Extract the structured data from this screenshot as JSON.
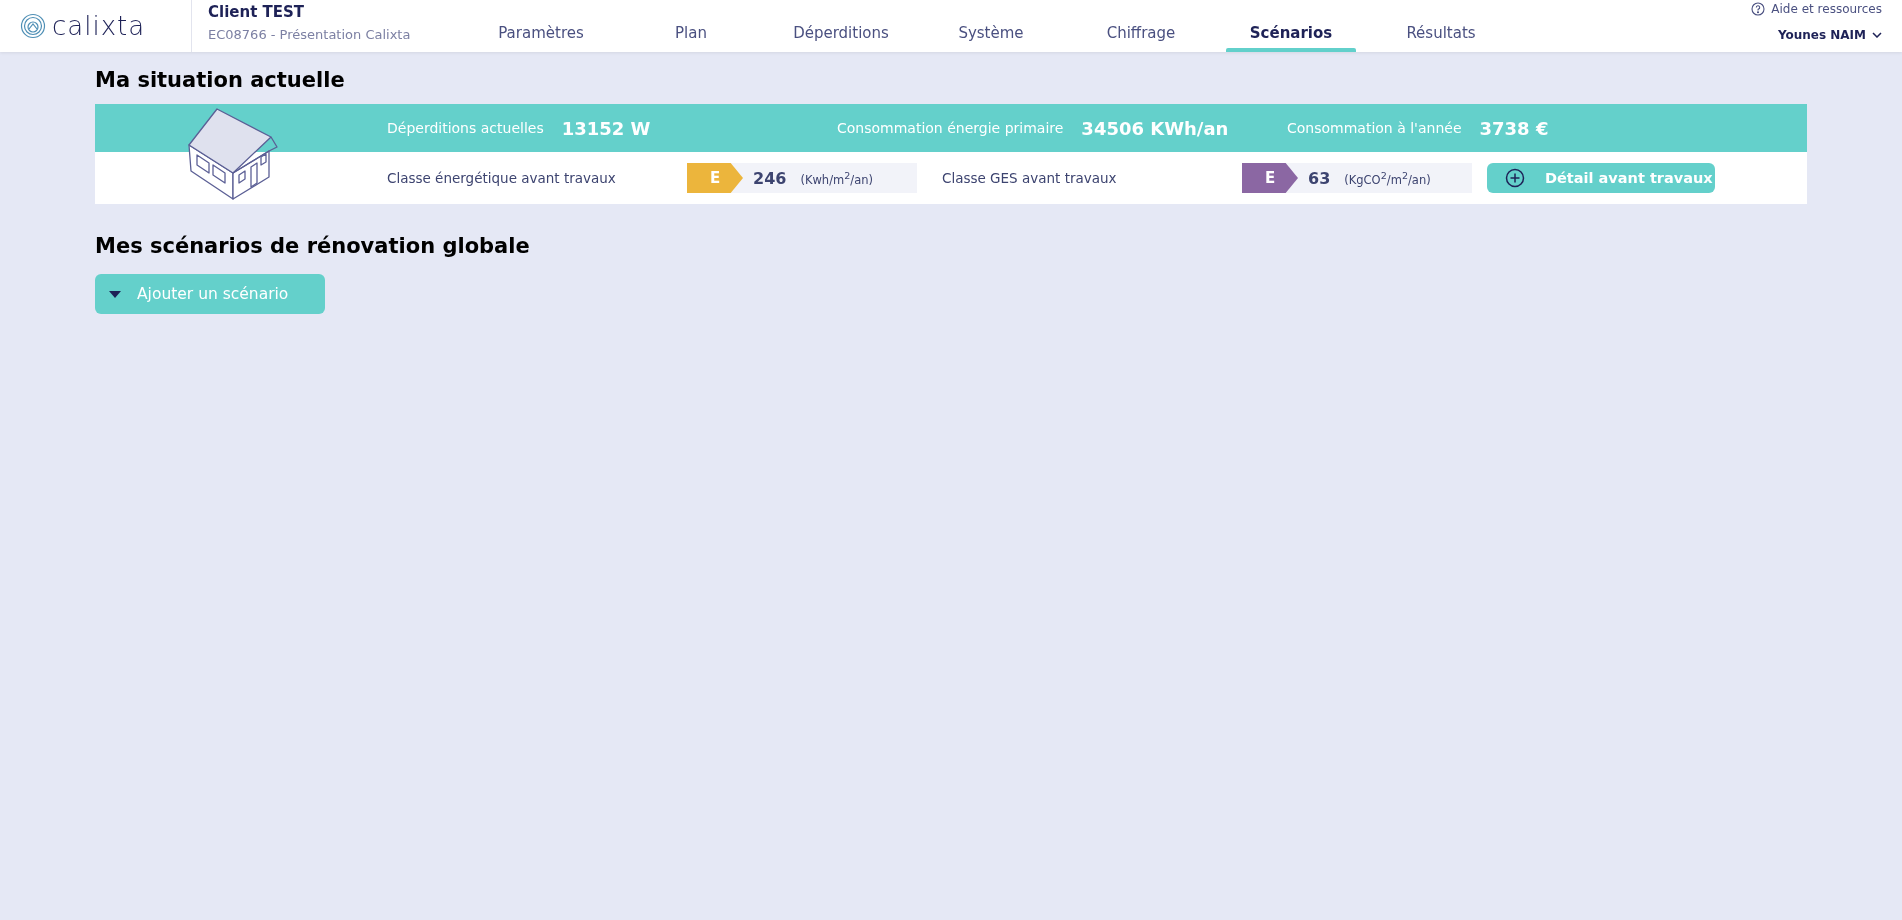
{
  "header": {
    "logo": "calixta",
    "client": "Client TEST",
    "project": "EC08766 - Présentation Calixta",
    "help": "Aide et ressources",
    "user": "Younes NAIM"
  },
  "tabs": [
    {
      "label": "Paramètres",
      "selected": false
    },
    {
      "label": "Plan",
      "selected": false
    },
    {
      "label": "Déperditions",
      "selected": false
    },
    {
      "label": "Système",
      "selected": false
    },
    {
      "label": "Chiffrage",
      "selected": false
    },
    {
      "label": "Scénarios",
      "selected": true
    },
    {
      "label": "Résultats",
      "selected": false
    }
  ],
  "situation": {
    "title": "Ma situation actuelle",
    "stats": [
      {
        "label": "Déperditions actuelles",
        "value": "13152 W"
      },
      {
        "label": "Consommation énergie primaire",
        "value": "34506 KWh/an"
      },
      {
        "label": "Consommation à l'année",
        "value": "3738 €"
      }
    ],
    "classes": [
      {
        "label": "Classe énergétique avant travaux",
        "grade": "E",
        "color": "#ecb53c",
        "value": "246",
        "unit": "(Kwh/m$^{2}$/an)"
      },
      {
        "label": "Classe GES avant travaux",
        "grade": "E",
        "color": "#8b67a3",
        "value": "63",
        "unit": "(KgCO$^{2}$/m$^{2}$/an)"
      }
    ],
    "detail_button": "Détail avant travaux"
  },
  "scenarios": {
    "title": "Mes scénarios de rénovation globale",
    "add_button": "Ajouter un scénario"
  }
}
